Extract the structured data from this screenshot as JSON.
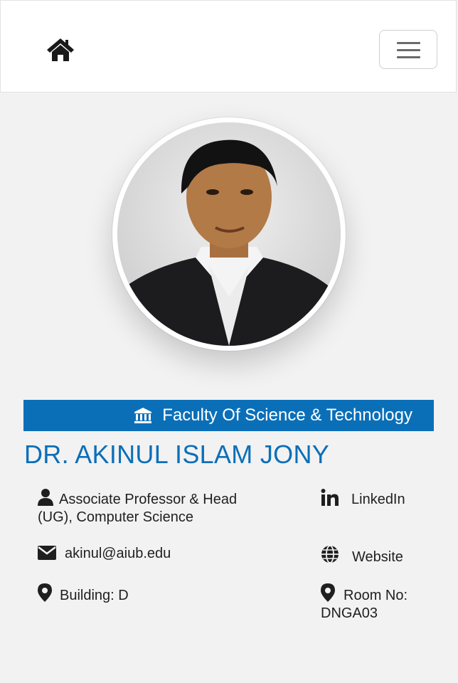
{
  "navbar": {
    "home_icon": "home-icon",
    "menu_icon": "hamburger-menu-icon"
  },
  "profile": {
    "faculty": "Faculty Of Science & Technology",
    "name": "DR. AKINUL ISLAM JONY",
    "designation": "Associate Professor & Head (UG), Computer Science",
    "email": "akinul@aiub.edu",
    "building": "Building: D",
    "linkedin_label": "LinkedIn",
    "website_label": "Website",
    "room": "Room No: DNGA03"
  },
  "colors": {
    "accent": "#0b6fb8",
    "background": "#f2f2f3"
  }
}
